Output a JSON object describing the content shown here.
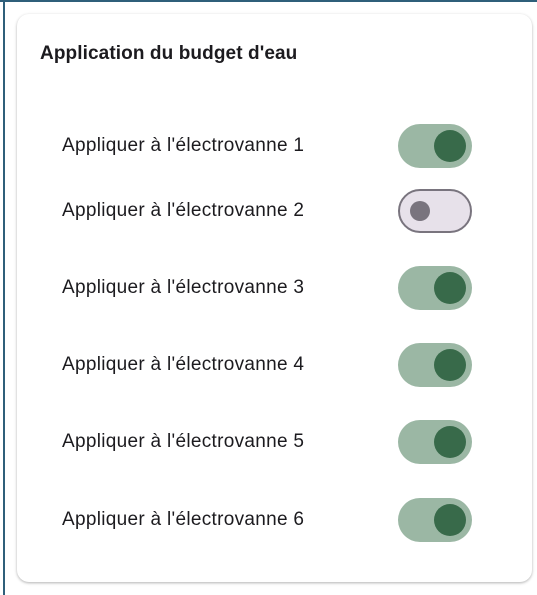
{
  "card": {
    "title": "Application du budget d'eau"
  },
  "rows": [
    {
      "label": "Appliquer à l'électrovanne 1",
      "enabled": true
    },
    {
      "label": "Appliquer à l'électrovanne 2",
      "enabled": false
    },
    {
      "label": "Appliquer à l'électrovanne 3",
      "enabled": true
    },
    {
      "label": "Appliquer à l'électrovanne 4",
      "enabled": true
    },
    {
      "label": "Appliquer à l'électrovanne 5",
      "enabled": true
    },
    {
      "label": "Appliquer à l'électrovanne 6",
      "enabled": true
    }
  ],
  "colors": {
    "track_on": "#9bb7a4",
    "thumb_on": "#386a4a",
    "track_off": "#e7e1ea",
    "outline_off": "#79747e",
    "text": "#1c1b1f"
  }
}
